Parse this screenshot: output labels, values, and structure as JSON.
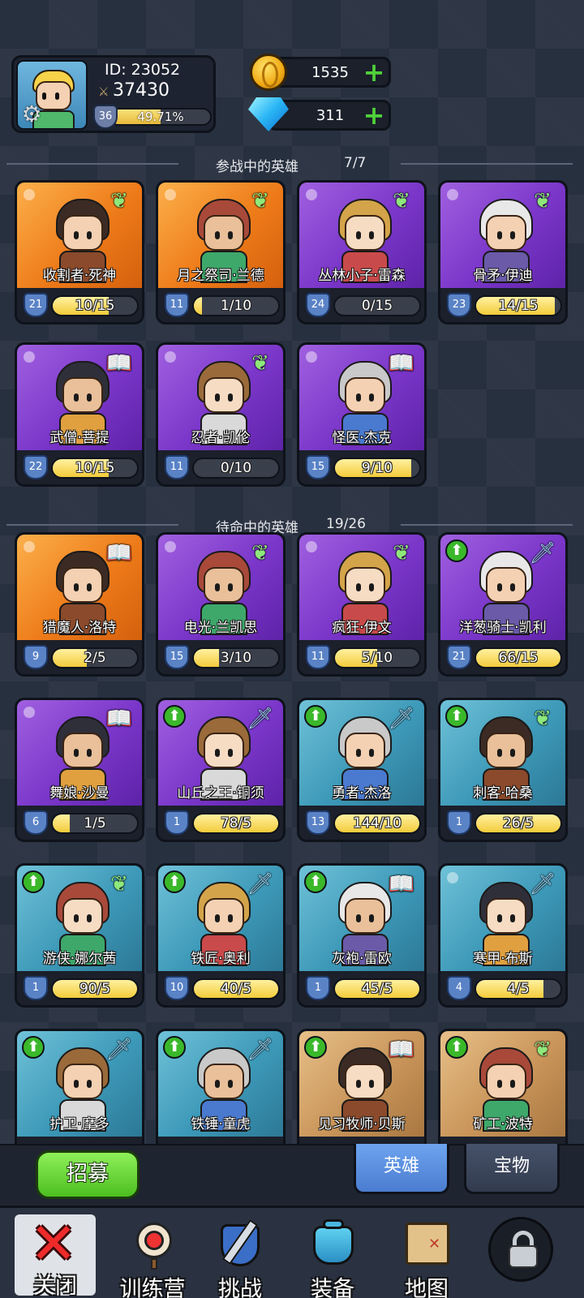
{
  "player": {
    "id_label": "ID: 23052",
    "power": "37430",
    "level": "36",
    "xp_percent_text": "49.71%",
    "xp_fraction": 0.4971
  },
  "currency": {
    "gold": "1535",
    "gems": "311"
  },
  "active_section": {
    "title": "参战中的英雄",
    "count": "7/7"
  },
  "standby_section": {
    "title": "待命中的英雄",
    "count": "19/26"
  },
  "active_heroes": [
    {
      "name": "收割者·死神",
      "level": "21",
      "shards": "10/15",
      "progress": 0.667,
      "rarity": "orange",
      "badge": "wing",
      "upgrade": false
    },
    {
      "name": "月之祭司·兰德",
      "level": "11",
      "shards": "1/10",
      "progress": 0.1,
      "rarity": "orange",
      "badge": "wing",
      "upgrade": false
    },
    {
      "name": "丛林小子·雷森",
      "level": "24",
      "shards": "0/15",
      "progress": 0,
      "rarity": "purple",
      "badge": "wing",
      "upgrade": false
    },
    {
      "name": "骨矛·伊迪",
      "level": "23",
      "shards": "14/15",
      "progress": 0.933,
      "rarity": "purple",
      "badge": "wing",
      "upgrade": false
    },
    {
      "name": "武僧·菩提",
      "level": "22",
      "shards": "10/15",
      "progress": 0.667,
      "rarity": "purple",
      "badge": "book",
      "upgrade": false
    },
    {
      "name": "忍者·凯伦",
      "level": "11",
      "shards": "0/10",
      "progress": 0,
      "rarity": "purple",
      "badge": "wing",
      "upgrade": false
    },
    {
      "name": "怪医·杰克",
      "level": "15",
      "shards": "9/10",
      "progress": 0.9,
      "rarity": "purple",
      "badge": "book",
      "upgrade": false
    }
  ],
  "standby_heroes": [
    {
      "name": "猎魔人·洛特",
      "level": "9",
      "shards": "2/5",
      "progress": 0.4,
      "rarity": "orange",
      "badge": "book",
      "upgrade": false
    },
    {
      "name": "电光·兰凯思",
      "level": "15",
      "shards": "3/10",
      "progress": 0.3,
      "rarity": "purple",
      "badge": "wing",
      "upgrade": false
    },
    {
      "name": "疯狂·伊文",
      "level": "11",
      "shards": "5/10",
      "progress": 0.5,
      "rarity": "purple",
      "badge": "wing",
      "upgrade": false
    },
    {
      "name": "洋葱骑士·凯利",
      "level": "21",
      "shards": "66/15",
      "progress": 1,
      "rarity": "purple",
      "badge": "sword",
      "upgrade": true
    },
    {
      "name": "舞娘·沙曼",
      "level": "6",
      "shards": "1/5",
      "progress": 0.2,
      "rarity": "purple",
      "badge": "book",
      "upgrade": false
    },
    {
      "name": "山丘之王·铜须",
      "level": "1",
      "shards": "78/5",
      "progress": 1,
      "rarity": "purple",
      "badge": "sword",
      "upgrade": true
    },
    {
      "name": "勇者·杰洛",
      "level": "13",
      "shards": "144/10",
      "progress": 1,
      "rarity": "blue",
      "badge": "sword",
      "upgrade": true
    },
    {
      "name": "刺客·哈桑",
      "level": "1",
      "shards": "26/5",
      "progress": 1,
      "rarity": "blue",
      "badge": "wing",
      "upgrade": true
    },
    {
      "name": "游侠·娜尔茜",
      "level": "1",
      "shards": "90/5",
      "progress": 1,
      "rarity": "blue",
      "badge": "wing",
      "upgrade": true
    },
    {
      "name": "铁匠·奥利",
      "level": "10",
      "shards": "40/5",
      "progress": 1,
      "rarity": "blue",
      "badge": "sword",
      "upgrade": true
    },
    {
      "name": "灰袍·雷欧",
      "level": "1",
      "shards": "45/5",
      "progress": 1,
      "rarity": "blue",
      "badge": "book",
      "upgrade": true
    },
    {
      "name": "寒甲·布斯",
      "level": "4",
      "shards": "4/5",
      "progress": 0.8,
      "rarity": "blue",
      "badge": "sword",
      "upgrade": false
    },
    {
      "name": "护卫·摩多",
      "level": "",
      "shards": "",
      "progress": 0,
      "rarity": "blue",
      "badge": "sword",
      "upgrade": true
    },
    {
      "name": "铁锤·童虎",
      "level": "",
      "shards": "",
      "progress": 0,
      "rarity": "blue",
      "badge": "sword",
      "upgrade": true
    },
    {
      "name": "见习牧师·贝斯",
      "level": "",
      "shards": "",
      "progress": 0,
      "rarity": "tan",
      "badge": "book",
      "upgrade": true
    },
    {
      "name": "矿工·波特",
      "level": "",
      "shards": "",
      "progress": 0,
      "rarity": "tan",
      "badge": "wing",
      "upgrade": true
    }
  ],
  "buttons": {
    "recruit": "招募",
    "tab_heroes": "英雄",
    "tab_treasure": "宝物"
  },
  "nav": {
    "close": "关闭",
    "training": "训练营",
    "challenge": "挑战",
    "equipment": "装备",
    "map": "地图"
  },
  "colors": {
    "bg": "#27303f",
    "orange": "#ee7b19",
    "purple": "#7a36c9",
    "blue": "#3d99b8",
    "tan": "#c9955a",
    "shard_fill": "#f3cc3b",
    "upgrade_green": "#3ab82a"
  }
}
